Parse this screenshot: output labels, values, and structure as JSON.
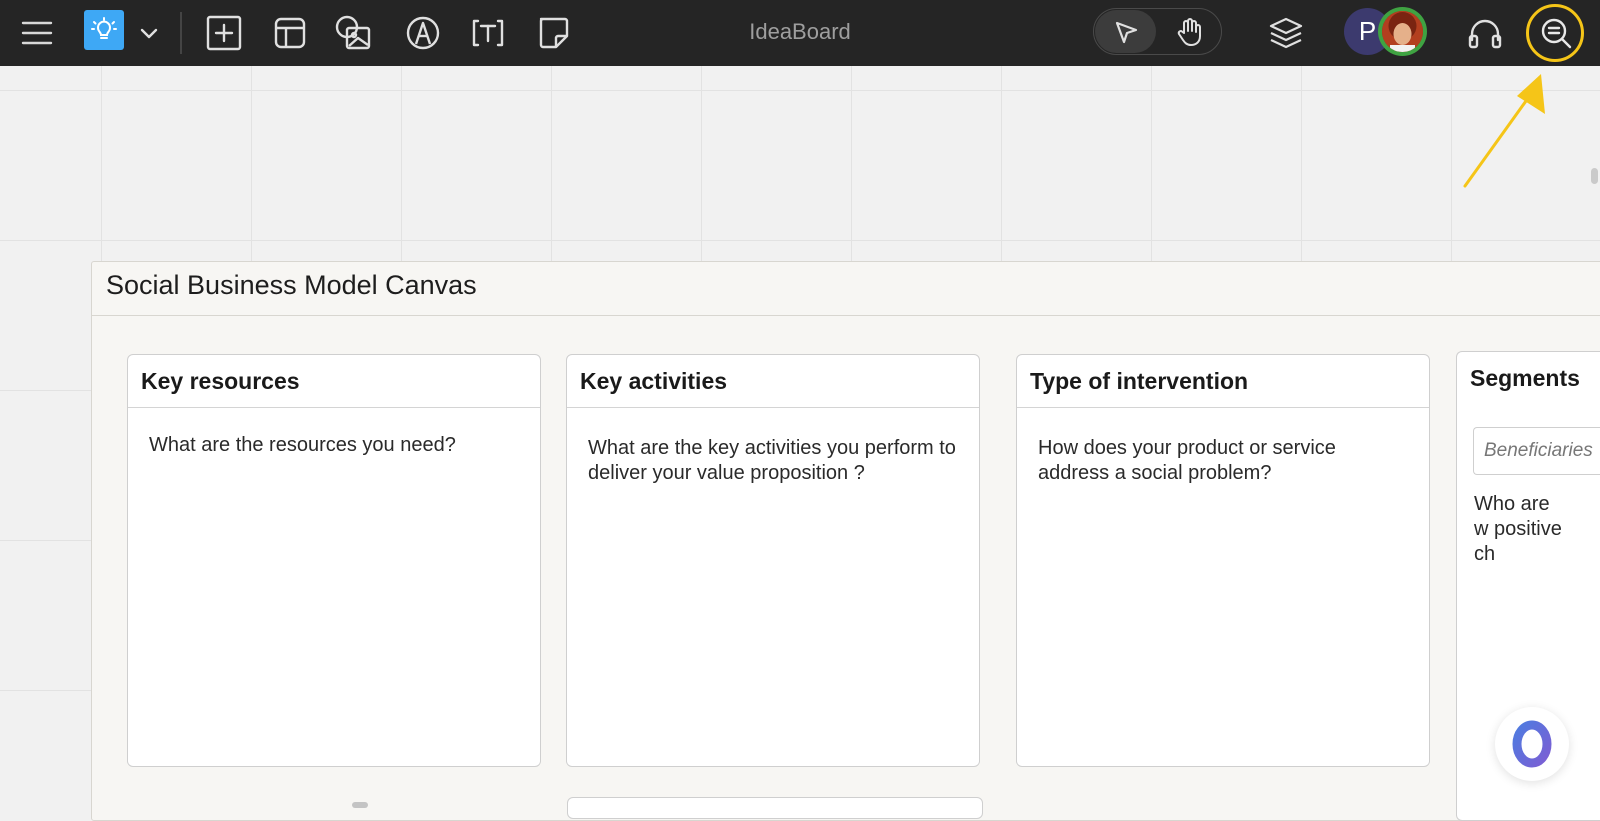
{
  "toolbar": {
    "app_title": "IdeaBoard",
    "avatar_initial": "P",
    "icons": [
      "hamburger-menu-icon",
      "lightbulb-icon",
      "chevron-down-icon",
      "add-frame-icon",
      "template-icon",
      "media-icon",
      "pen-icon",
      "text-icon",
      "sticky-note-icon",
      "select-pointer-icon",
      "hand-pan-icon",
      "layers-icon",
      "headphones-icon",
      "search-icon"
    ],
    "highlight_color": "#f5c518",
    "accent_color": "#3ea8f5"
  },
  "canvas": {
    "frame_title": "Social Business Model Canvas",
    "cards": [
      {
        "title": "Key resources",
        "prompt": "What are the resources you need?"
      },
      {
        "title": "Key activities",
        "prompt": "What are the key activities you perform to deliver your value proposition ?"
      },
      {
        "title": "Type of intervention",
        "prompt": "How does your product or service address a social problem?"
      },
      {
        "title": "Segments",
        "subtitle": "Beneficiaries",
        "prompt": "Who are w positive ch"
      }
    ]
  }
}
